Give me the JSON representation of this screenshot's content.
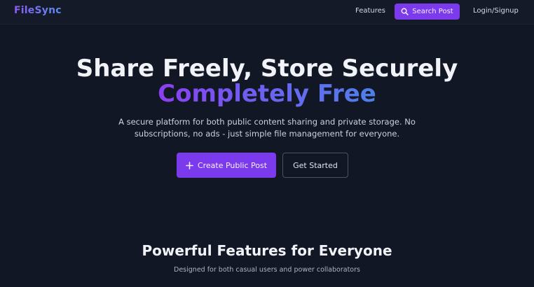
{
  "nav": {
    "brand": "FileSync",
    "features_label": "Features",
    "search_label": "Search Post",
    "login_label": "Login/Signup",
    "search_icon": "search-icon"
  },
  "hero": {
    "title": "Share Freely, Store Securely",
    "accent": "Completely Free",
    "subtitle": "A secure platform for both public content sharing and private storage. No subscriptions, no ads - just simple file management for everyone.",
    "primary_button": "Create Public Post",
    "primary_icon": "plus-icon",
    "secondary_button": "Get Started"
  },
  "features": {
    "title": "Powerful Features for Everyone",
    "subtitle": "Designed for both casual users and power collaborators"
  },
  "colors": {
    "background": "#121726",
    "accent_purple": "#7c3aed",
    "accent_blue": "#4f7fe8",
    "text_primary": "#f1f3f8"
  }
}
